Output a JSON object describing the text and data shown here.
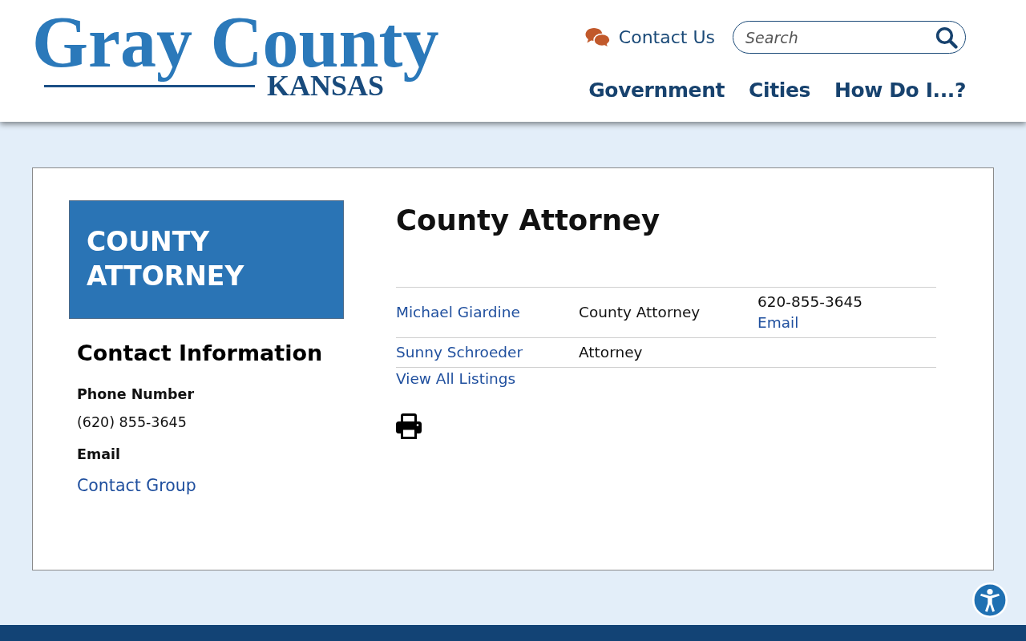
{
  "header": {
    "logo": {
      "title": "Gray County",
      "subtitle": "KANSAS"
    },
    "contact_link": "Contact Us",
    "search": {
      "placeholder": "Search"
    },
    "nav": [
      "Government",
      "Cities",
      "How Do I...?"
    ]
  },
  "sidebar": {
    "banner": "COUNTY ATTORNEY",
    "heading": "Contact Information",
    "fields": [
      {
        "kind": "text",
        "label": "Phone Number",
        "value": "(620) 855-3645"
      },
      {
        "kind": "link",
        "label": "Email",
        "value": "Contact Group"
      }
    ]
  },
  "main": {
    "title": "County Attorney",
    "staff": [
      {
        "name": "Michael Giardine",
        "title": "County Attorney",
        "phone": "620-855-3645",
        "email": "Email"
      },
      {
        "name": "Sunny Schroeder",
        "title": "Attorney"
      }
    ],
    "view_all": "View All Listings"
  }
}
